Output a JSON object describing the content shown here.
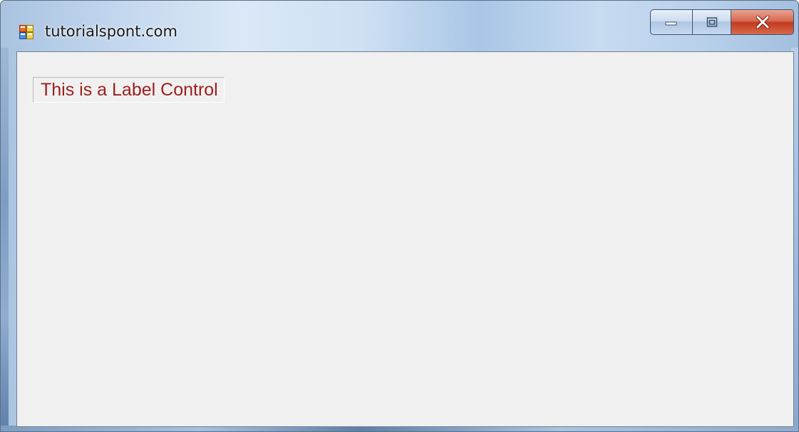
{
  "window": {
    "title": "tutorialspont.com",
    "icon": "winforms-app-icon"
  },
  "caption_buttons": {
    "minimize_icon": "minimize-icon",
    "maximize_icon": "maximize-icon",
    "close_icon": "close-icon"
  },
  "form": {
    "label_text": "This is a Label Control",
    "label_color": "#9c1f1f",
    "background_color": "#f0f0f0"
  }
}
